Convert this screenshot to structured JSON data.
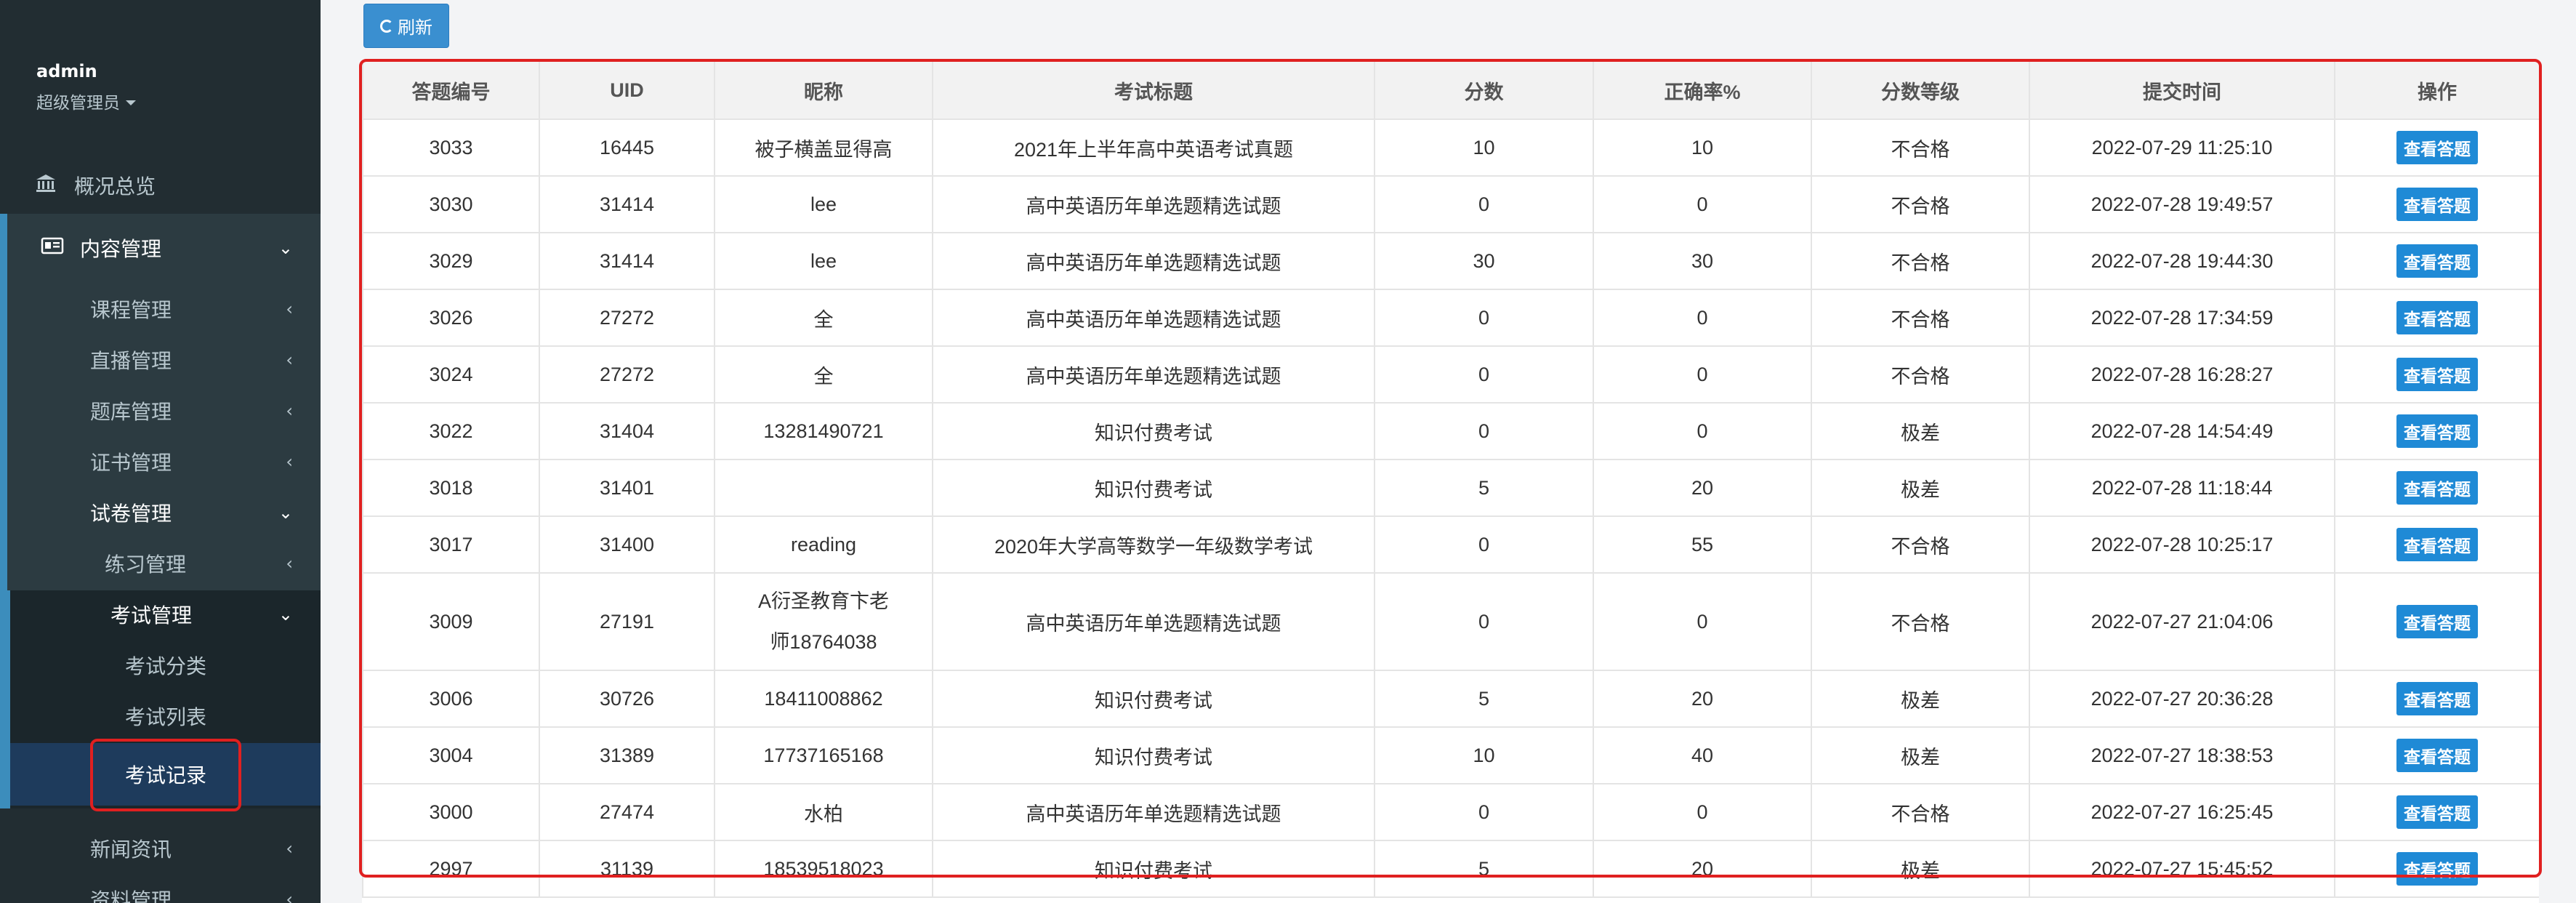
{
  "sidebar": {
    "user": {
      "name": "admin",
      "role": "超级管理员"
    },
    "overview": "概况总览",
    "content_mgmt": "内容管理",
    "items": [
      "课程管理",
      "直播管理",
      "题库管理",
      "证书管理"
    ],
    "paper_mgmt": "试卷管理",
    "practice_mgmt": "练习管理",
    "exam_mgmt": "考试管理",
    "exam_children": [
      "考试分类",
      "考试列表",
      "考试记录"
    ],
    "news": "新闻资讯",
    "resources": "资料管理"
  },
  "toolbar": {
    "refresh_label": "刷新"
  },
  "table": {
    "headers": [
      "答题编号",
      "UID",
      "昵称",
      "考试标题",
      "分数",
      "正确率%",
      "分数等级",
      "提交时间",
      "操作"
    ],
    "action_label": "查看答题",
    "rows": [
      [
        "3033",
        "16445",
        "被子横盖显得高",
        "2021年上半年高中英语考试真题",
        "10",
        "10",
        "不合格",
        "2022-07-29 11:25:10"
      ],
      [
        "3030",
        "31414",
        "lee",
        "高中英语历年单选题精选试题",
        "0",
        "0",
        "不合格",
        "2022-07-28 19:49:57"
      ],
      [
        "3029",
        "31414",
        "lee",
        "高中英语历年单选题精选试题",
        "30",
        "30",
        "不合格",
        "2022-07-28 19:44:30"
      ],
      [
        "3026",
        "27272",
        "全",
        "高中英语历年单选题精选试题",
        "0",
        "0",
        "不合格",
        "2022-07-28 17:34:59"
      ],
      [
        "3024",
        "27272",
        "全",
        "高中英语历年单选题精选试题",
        "0",
        "0",
        "不合格",
        "2022-07-28 16:28:27"
      ],
      [
        "3022",
        "31404",
        "13281490721",
        "知识付费考试",
        "0",
        "0",
        "极差",
        "2022-07-28 14:54:49"
      ],
      [
        "3018",
        "31401",
        "",
        "知识付费考试",
        "5",
        "20",
        "极差",
        "2022-07-28 11:18:44"
      ],
      [
        "3017",
        "31400",
        "reading",
        "2020年大学高等数学一年级数学考试",
        "0",
        "55",
        "不合格",
        "2022-07-28 10:25:17"
      ],
      [
        "3009",
        "27191",
        "A衍圣教育卞老师18764038",
        "高中英语历年单选题精选试题",
        "0",
        "0",
        "不合格",
        "2022-07-27 21:04:06"
      ],
      [
        "3006",
        "30726",
        "18411008862",
        "知识付费考试",
        "5",
        "20",
        "极差",
        "2022-07-27 20:36:28"
      ],
      [
        "3004",
        "31389",
        "17737165168",
        "知识付费考试",
        "10",
        "40",
        "极差",
        "2022-07-27 18:38:53"
      ],
      [
        "3000",
        "27474",
        "水柏",
        "高中英语历年单选题精选试题",
        "0",
        "0",
        "不合格",
        "2022-07-27 16:25:45"
      ],
      [
        "2997",
        "31139",
        "18539518023",
        "知识付费考试",
        "5",
        "20",
        "极差",
        "2022-07-27 15:45:52"
      ]
    ]
  },
  "colors": {
    "sidebar_bg": "#222d32",
    "accent": "#3c8dbc",
    "highlight": "#e02020"
  }
}
